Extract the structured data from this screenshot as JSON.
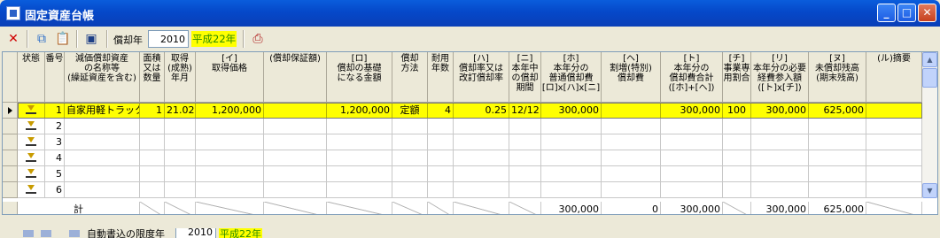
{
  "window": {
    "title": "固定資産台帳"
  },
  "toolbar": {
    "year_label": "償却年",
    "year_value": "2010",
    "era_label": "平成22年"
  },
  "columns": [
    {
      "key": "state",
      "label": "状態"
    },
    {
      "key": "no",
      "label": "番号"
    },
    {
      "key": "name",
      "label": "減価償却資産\nの名称等\n(繰延資産を含む)"
    },
    {
      "key": "qty",
      "label": "面積\n又は\n数量"
    },
    {
      "key": "acq_date",
      "label": "取得\n(成熟)\n年月"
    },
    {
      "key": "price",
      "label": "[イ]\n取得価格"
    },
    {
      "key": "guarantee",
      "label": "(償却保証額)"
    },
    {
      "key": "basis",
      "label": "[ロ]\n償却の基礎\nになる金額"
    },
    {
      "key": "method",
      "label": "償却\n方法"
    },
    {
      "key": "life",
      "label": "耐用\n年数"
    },
    {
      "key": "rate",
      "label": "[ハ]\n償却率又は\n改訂償却率"
    },
    {
      "key": "months",
      "label": "[ニ]\n本年中\nの償却\n期間"
    },
    {
      "key": "normal_dep",
      "label": "[ホ]\n本年分の\n普通償却費\n[ロ]x[ハ]x[ニ]"
    },
    {
      "key": "special_dep",
      "label": "[ヘ]\n割増(特別)\n償却費"
    },
    {
      "key": "total_dep",
      "label": "[ト]\n本年分の\n償却費合計\n([ホ]+[ヘ])"
    },
    {
      "key": "biz_ratio",
      "label": "[チ]\n事業専\n用割合"
    },
    {
      "key": "expense",
      "label": "[リ]\n本年分の必要\n経費参入額\n([ト]x[チ])"
    },
    {
      "key": "balance",
      "label": "[ヌ]\n未償却残高\n(期末残高)"
    },
    {
      "key": "note",
      "label": "(ル)摘要"
    }
  ],
  "rows": [
    {
      "no": "1",
      "name": "自家用軽トラック",
      "qty": "1",
      "acq_date": "21.02",
      "price": "1,200,000",
      "guarantee": "",
      "basis": "1,200,000",
      "method": "定額",
      "life": "4",
      "rate": "0.25",
      "months": "12/12",
      "normal_dep": "300,000",
      "special_dep": "",
      "total_dep": "300,000",
      "biz_ratio": "100",
      "expense": "300,000",
      "balance": "625,000",
      "note": ""
    },
    {
      "no": "2"
    },
    {
      "no": "3"
    },
    {
      "no": "4"
    },
    {
      "no": "5"
    },
    {
      "no": "6"
    }
  ],
  "totals": {
    "label": "計",
    "normal_dep": "300,000",
    "special_dep": "0",
    "total_dep": "300,000",
    "expense": "300,000",
    "balance": "625,000"
  },
  "bottom": {
    "label": "自動書込の限度年",
    "year_value": "2010",
    "era_label": "平成22年"
  }
}
